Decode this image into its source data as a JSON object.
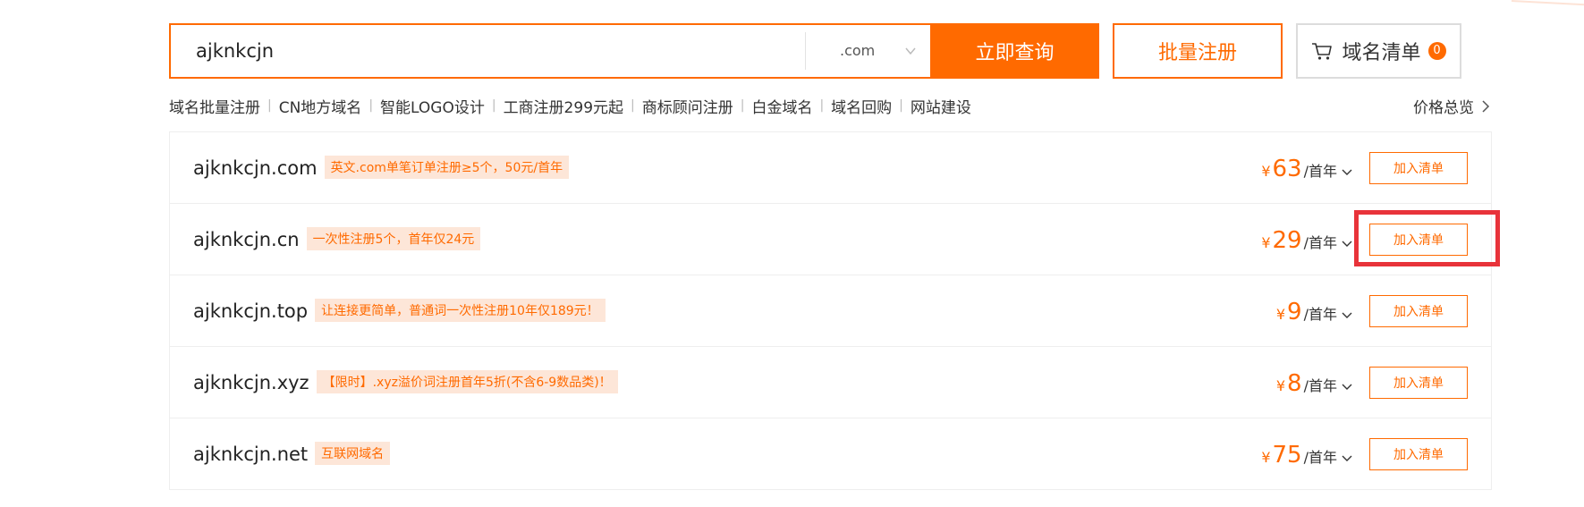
{
  "search": {
    "query": "ajknkcjn",
    "tld": ".com",
    "submit_label": "立即查询"
  },
  "bulk_register_label": "批量注册",
  "cart": {
    "label": "域名清单",
    "count": "0"
  },
  "quick_links": [
    "域名批量注册",
    "CN地方域名",
    "智能LOGO设计",
    "工商注册299元起",
    "商标顾问注册",
    "白金域名",
    "域名回购",
    "网站建设"
  ],
  "quick_link_separator": "|",
  "price_overview_label": "价格总览",
  "results": [
    {
      "domain": "ajknkcjn.com",
      "promo": "英文.com单笔订单注册≥5个，50元/首年",
      "currency": "¥",
      "price": "63",
      "unit": "/首年",
      "action": "加入清单"
    },
    {
      "domain": "ajknkcjn.cn",
      "promo": "一次性注册5个，首年仅24元",
      "currency": "¥",
      "price": "29",
      "unit": "/首年",
      "action": "加入清单"
    },
    {
      "domain": "ajknkcjn.top",
      "promo": "让连接更简单，普通词一次性注册10年仅189元！",
      "currency": "¥",
      "price": "9",
      "unit": "/首年",
      "action": "加入清单"
    },
    {
      "domain": "ajknkcjn.xyz",
      "promo": "【限时】.xyz溢价词注册首年5折(不含6-9数品类)！",
      "currency": "¥",
      "price": "8",
      "unit": "/首年",
      "action": "加入清单"
    },
    {
      "domain": "ajknkcjn.net",
      "promo": "互联网域名",
      "currency": "¥",
      "price": "75",
      "unit": "/首年",
      "action": "加入清单"
    }
  ],
  "colors": {
    "accent": "#ff6a00",
    "promo_bg": "#fde6d8",
    "highlight": "#e8333a",
    "border": "#eeeeee"
  },
  "icons": {
    "cart": "cart-icon",
    "tld_dropdown": "chevron-down-icon",
    "price_overview": "chevron-right-icon",
    "price_unit": "chevron-down-icon"
  }
}
